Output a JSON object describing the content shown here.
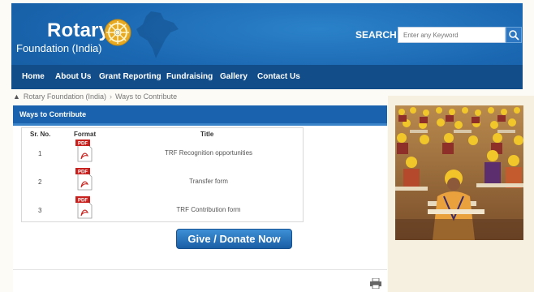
{
  "header": {
    "logo": {
      "name": "Rotary",
      "subtitle": "Foundation (India)"
    },
    "search": {
      "label": "SEARCH",
      "placeholder": "Enter any Keyword"
    },
    "nav": [
      "Home",
      "About Us",
      "Grant Reporting",
      "Fundraising",
      "Gallery",
      "Contact Us"
    ]
  },
  "breadcrumb": {
    "items": [
      "Rotary Foundation (India)",
      "Ways to Contribute"
    ]
  },
  "panel": {
    "title": "Ways to Contribute",
    "columns": [
      "Sr. No.",
      "Format",
      "Title"
    ],
    "rows": [
      {
        "sr": "1",
        "format": "PDF",
        "title": "TRF Recognition opportunities"
      },
      {
        "sr": "2",
        "format": "PDF",
        "title": "Transfer form"
      },
      {
        "sr": "3",
        "format": "PDF",
        "title": "TRF Contribution form"
      }
    ],
    "donate_label": "Give / Donate Now"
  },
  "colors": {
    "header_blue": "#1a66b0",
    "nav_blue": "#124d8a",
    "panel_blue": "#1a62ad",
    "pdf_red": "#c8211d"
  }
}
